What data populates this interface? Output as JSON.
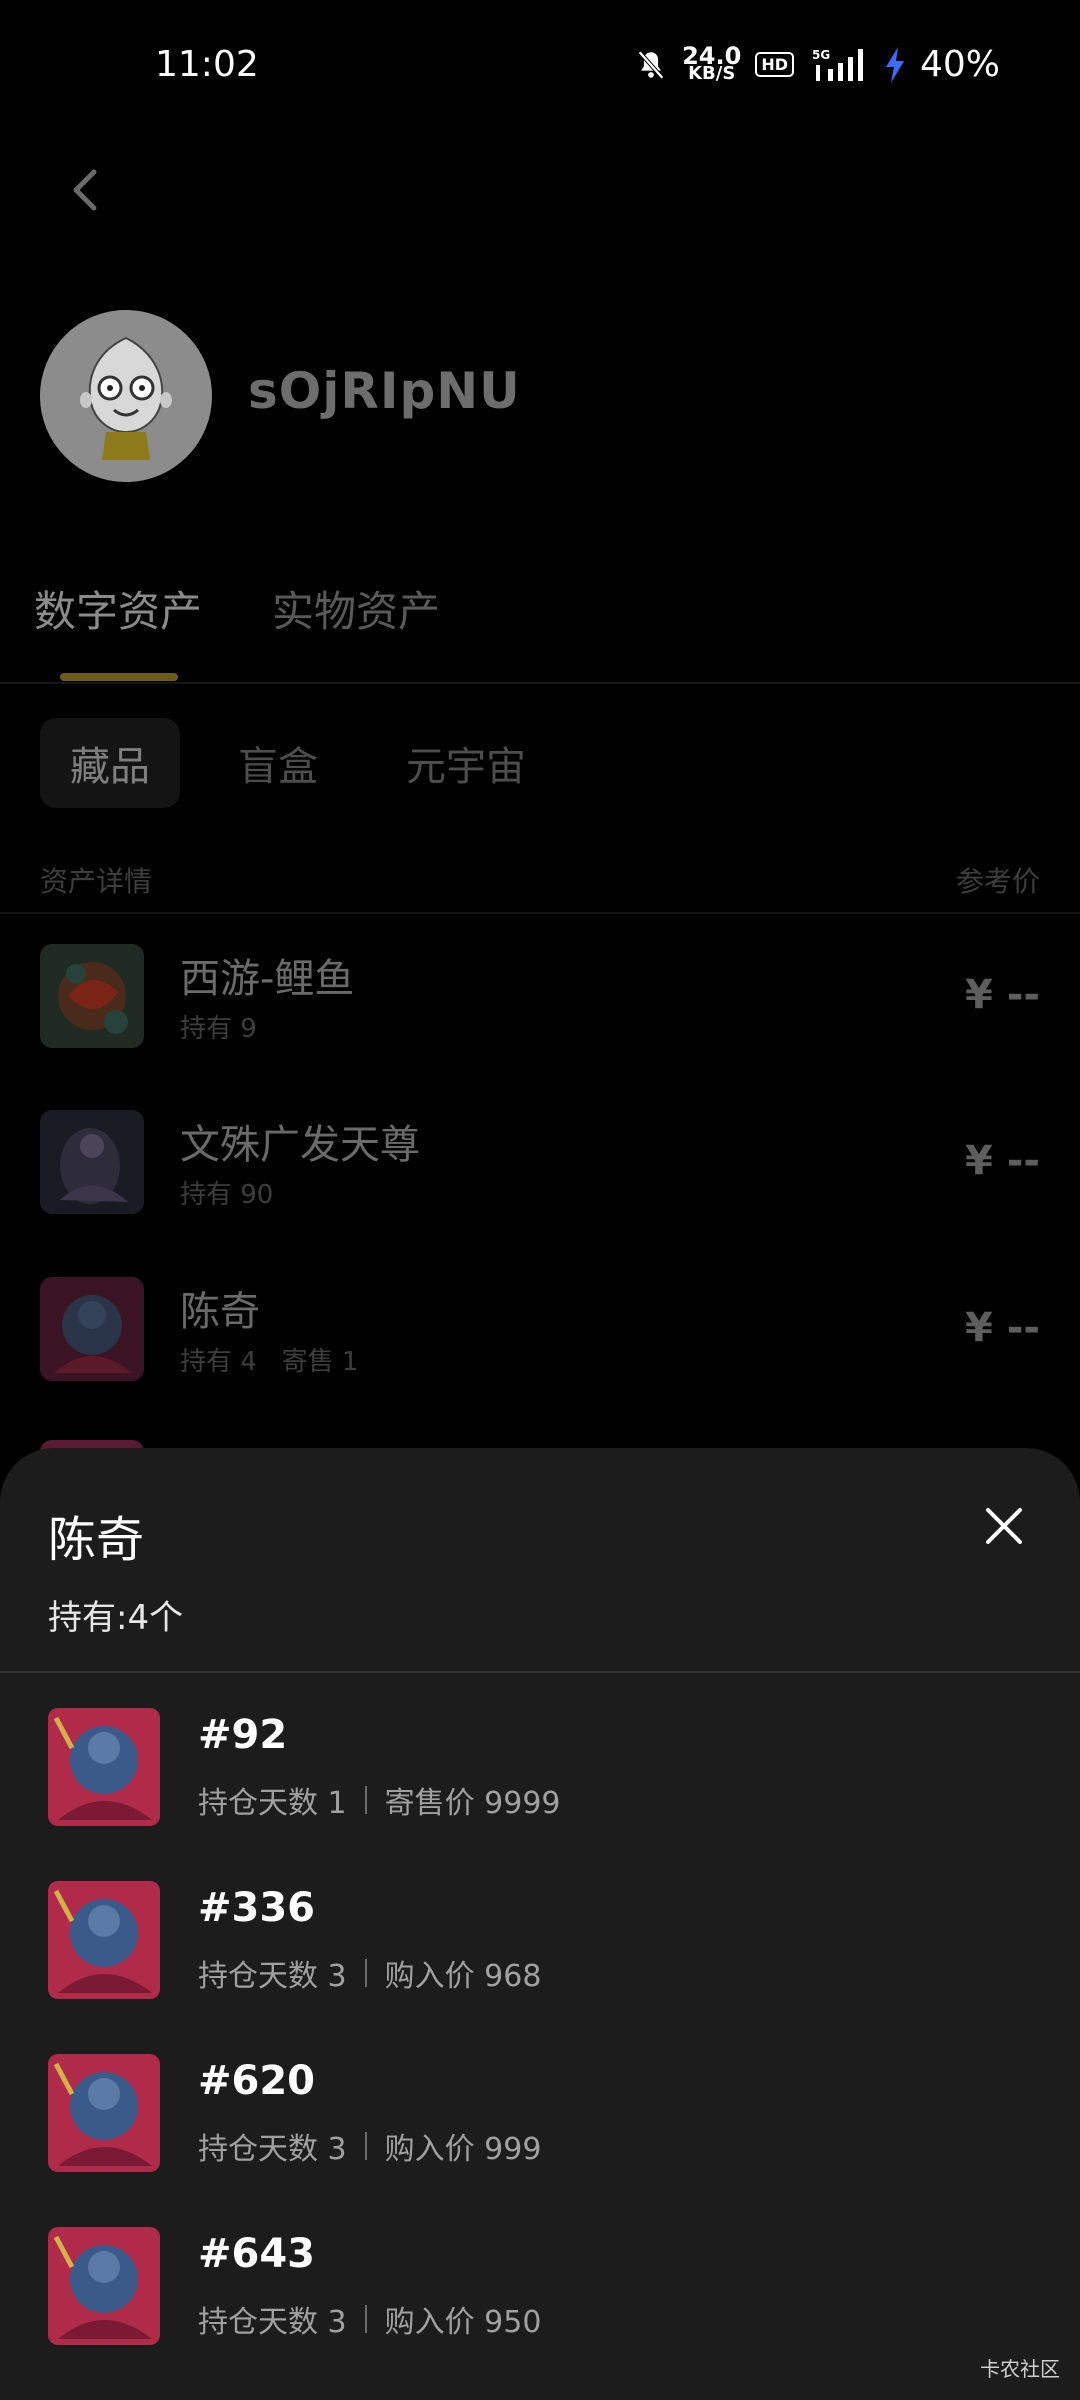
{
  "status": {
    "time": "11:02",
    "speed_value": "24.0",
    "speed_unit": "KB/S",
    "hd": "HD",
    "network": "5G",
    "battery": "40%"
  },
  "profile": {
    "username": "sOjRIpNU"
  },
  "main_tabs": [
    {
      "label": "数字资产",
      "active": true
    },
    {
      "label": "实物资产",
      "active": false
    }
  ],
  "sub_tabs": [
    {
      "label": "藏品",
      "active": true
    },
    {
      "label": "盲盒",
      "active": false
    },
    {
      "label": "元宇宙",
      "active": false
    }
  ],
  "list_header": {
    "left": "资产详情",
    "right": "参考价"
  },
  "assets": [
    {
      "name": "西游-鲤鱼",
      "meta": "持有 9",
      "price": "¥ --"
    },
    {
      "name": "文殊广发天尊",
      "meta": "持有 90",
      "price": "¥ --"
    },
    {
      "name": "陈奇",
      "meta": "持有 4   寄售 1",
      "price": "¥ --"
    }
  ],
  "sheet": {
    "title": "陈奇",
    "count": "持有:4个",
    "items": [
      {
        "number": "#92",
        "days": "持仓天数 1",
        "price": "寄售价 9999"
      },
      {
        "number": "#336",
        "days": "持仓天数 3",
        "price": "购入价 968"
      },
      {
        "number": "#620",
        "days": "持仓天数 3",
        "price": "购入价 999"
      },
      {
        "number": "#643",
        "days": "持仓天数 3",
        "price": "购入价 950"
      }
    ]
  },
  "watermark": "卡农社区",
  "colors": {
    "accent": "#6e5a1c",
    "sheet_bg": "#1c1c1c",
    "page_bg": "#000000"
  }
}
